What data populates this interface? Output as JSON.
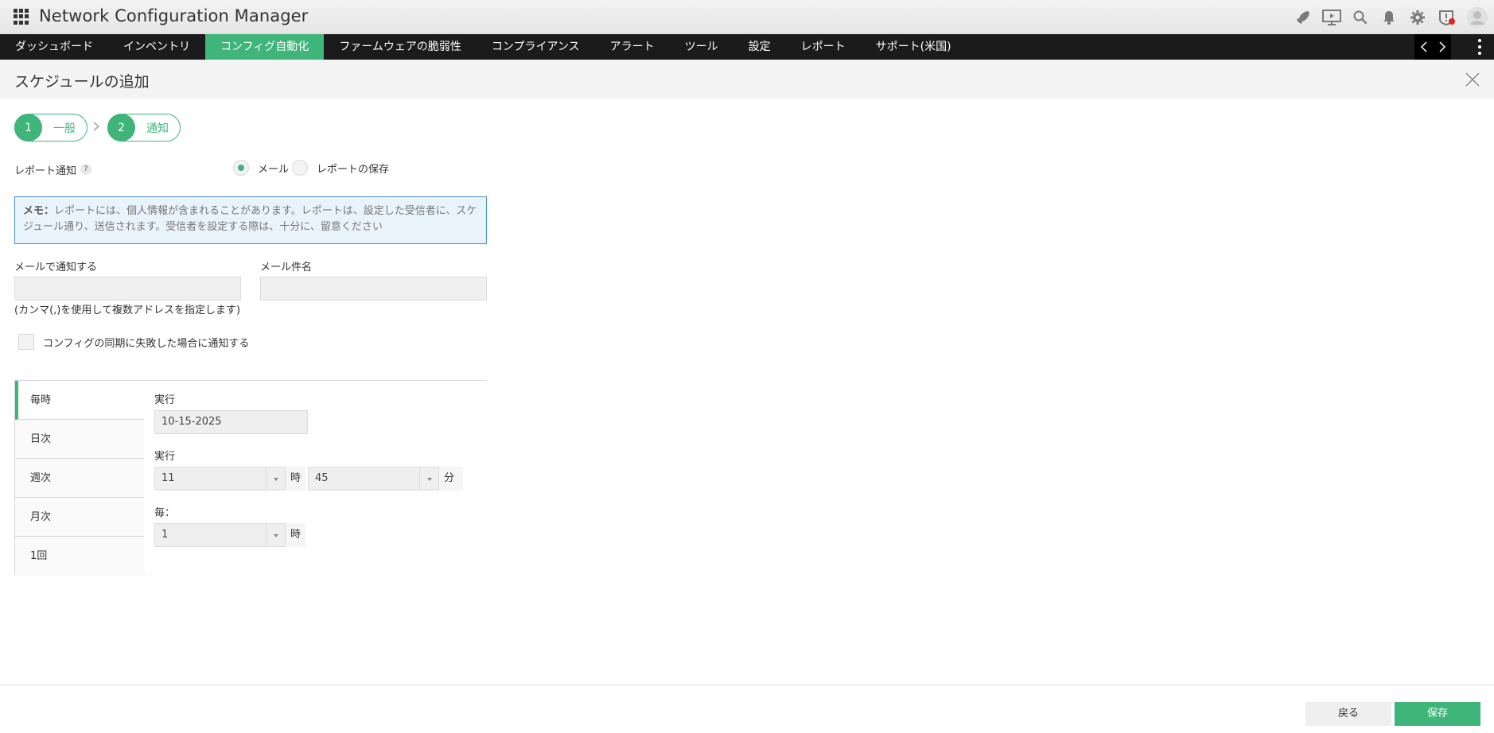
{
  "app": {
    "title": "Network Configuration Manager"
  },
  "header_icons": [
    "rocket-icon",
    "screen-icon",
    "search-icon",
    "bell-icon",
    "gear-icon",
    "shield-alert-icon",
    "user-avatar-icon"
  ],
  "nav": {
    "items": [
      {
        "label": "ダッシュボード"
      },
      {
        "label": "インベントリ"
      },
      {
        "label": "コンフィグ自動化"
      },
      {
        "label": "ファームウェアの脆弱性"
      },
      {
        "label": "コンプライアンス"
      },
      {
        "label": "アラート"
      },
      {
        "label": "ツール"
      },
      {
        "label": "設定"
      },
      {
        "label": "レポート"
      },
      {
        "label": "サポート(米国)"
      }
    ],
    "active": "コンフィグ自動化"
  },
  "page": {
    "title": "スケジュールの追加"
  },
  "steps": [
    {
      "num": "1",
      "label": "一般"
    },
    {
      "num": "2",
      "label": "通知"
    }
  ],
  "form": {
    "report_notify_label": "レポート通知",
    "help": "?",
    "radio_mail": "メール",
    "radio_save": "レポートの保存",
    "selected_radio": "メール",
    "note_title": "メモ：",
    "note_text": "レポートには、個人情報が含まれることがあります。レポートは、設定した受信者に、スケジュール通り、送信されます。受信者を設定する際は、十分に、留意ください",
    "email_notify_label": "メールで通知する",
    "email_notify_value": "",
    "email_subject_label": "メール件名",
    "email_subject_value": "",
    "comma_hint": "(カンマ(,)を使用して複数アドレスを指定します)",
    "sync_fail_label": "コンフィグの同期に失敗した場合に通知する",
    "sync_fail_checked": false
  },
  "schedule": {
    "tabs": [
      {
        "label": "毎時"
      },
      {
        "label": "日次"
      },
      {
        "label": "週次"
      },
      {
        "label": "月次"
      },
      {
        "label": "1回"
      }
    ],
    "active_tab": "毎時",
    "run_label_1": "実行",
    "date_value": "10-15-2025",
    "run_label_2": "実行",
    "hour_value": "11",
    "hour_unit": "時",
    "minute_value": "45",
    "minute_unit": "分",
    "every_label": "毎：",
    "every_value": "1",
    "every_unit": "時"
  },
  "footer": {
    "back_label": "戻る",
    "save_label": "保存"
  },
  "colors": {
    "accent": "#3fb57a",
    "navbar": "#1b1b1b",
    "note_border": "#4b8fd6",
    "note_bg": "#e9f3fc",
    "alert": "#e2231a"
  }
}
